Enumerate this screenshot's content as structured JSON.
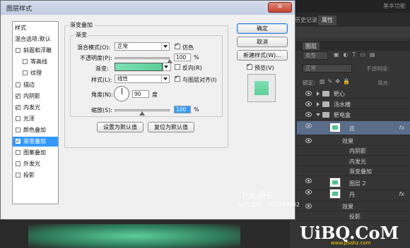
{
  "photoshop_panel": {
    "workspace_label": "基本功能",
    "tabs": [
      "历史记录",
      "属性"
    ],
    "active_tab": "属性",
    "layers_tab": "图层",
    "kind_filter": "类型",
    "blend_mode": "正常",
    "opacity_label": "不透明度:",
    "lock_label": "锁定:",
    "fill_label": "填充:",
    "rows": [
      {
        "name": "靶心",
        "type": "folder"
      },
      {
        "name": "汤水槽",
        "type": "folder"
      },
      {
        "name": "靶电盒",
        "type": "folder-open"
      },
      {
        "name": "底",
        "type": "layer",
        "fx": "fx"
      },
      {
        "name": "效果",
        "type": "effects"
      },
      {
        "name": "内阴影",
        "type": "effect"
      },
      {
        "name": "内发光",
        "type": "effect"
      },
      {
        "name": "渐变叠加",
        "type": "effect"
      },
      {
        "name": "图层 2",
        "type": "layer"
      },
      {
        "name": "丹",
        "type": "layer",
        "fx": "fx"
      },
      {
        "name": "效果",
        "type": "effects"
      },
      {
        "name": "投影",
        "type": "effect"
      }
    ]
  },
  "dialog": {
    "title": "图层样式",
    "close_label": "✕",
    "sidebar": [
      {
        "label": "样式",
        "checkbox": false,
        "checked": false,
        "selected": false,
        "indent": 0
      },
      {
        "label": "混合选项:默认",
        "checkbox": false,
        "checked": false,
        "selected": false,
        "indent": 0
      },
      {
        "label": "斜面和浮雕",
        "checkbox": true,
        "checked": false,
        "selected": false,
        "indent": 0
      },
      {
        "label": "等高线",
        "checkbox": true,
        "checked": false,
        "selected": false,
        "indent": 1
      },
      {
        "label": "纹理",
        "checkbox": true,
        "checked": false,
        "selected": false,
        "indent": 1
      },
      {
        "label": "描边",
        "checkbox": true,
        "checked": false,
        "selected": false,
        "indent": 0
      },
      {
        "label": "内阴影",
        "checkbox": true,
        "checked": true,
        "selected": false,
        "indent": 0
      },
      {
        "label": "内发光",
        "checkbox": true,
        "checked": true,
        "selected": false,
        "indent": 0
      },
      {
        "label": "光泽",
        "checkbox": true,
        "checked": false,
        "selected": false,
        "indent": 0
      },
      {
        "label": "颜色叠加",
        "checkbox": true,
        "checked": false,
        "selected": false,
        "indent": 0
      },
      {
        "label": "渐变叠加",
        "checkbox": true,
        "checked": true,
        "selected": true,
        "indent": 0
      },
      {
        "label": "图案叠加",
        "checkbox": true,
        "checked": false,
        "selected": false,
        "indent": 0
      },
      {
        "label": "外发光",
        "checkbox": true,
        "checked": false,
        "selected": false,
        "indent": 0
      },
      {
        "label": "投影",
        "checkbox": true,
        "checked": false,
        "selected": false,
        "indent": 0
      }
    ],
    "section_title": "渐变叠加",
    "group_title": "渐变",
    "blend_mode_label": "混合模式(O):",
    "blend_mode_value": "正常",
    "dither_label": "仿色",
    "dither_checked": true,
    "opacity_label": "不透明度(P):",
    "opacity_value": "100",
    "opacity_unit": "%",
    "opacity_level": 100,
    "gradient_label": "渐变:",
    "gradient_colors": [
      "#7ee0b3",
      "#5ccf9a"
    ],
    "reverse_label": "反向(R)",
    "reverse_checked": false,
    "style_label": "样式(L):",
    "style_value": "线性",
    "align_label": "与图层对齐(I)",
    "align_checked": true,
    "angle_label": "角度(N):",
    "angle_value": "90",
    "angle_unit": "度",
    "scale_label": "缩放(S):",
    "scale_value": "100",
    "scale_unit": "%",
    "scale_level": 100,
    "make_default_label": "设置为默认值",
    "reset_default_label": "复位为默认值",
    "ok_label": "确定",
    "cancel_label": "取消",
    "new_style_label": "新建样式(W)...",
    "preview_label": "预览(V)",
    "preview_checked": true,
    "preview_color": "#5ccf9a"
  },
  "watermark": {
    "brand": "P大点S",
    "qq": "qq交流群：",
    "qq_number": "301384032",
    "site_logo": "UiBQ.CoM",
    "site_url": "www.psahz.com"
  }
}
